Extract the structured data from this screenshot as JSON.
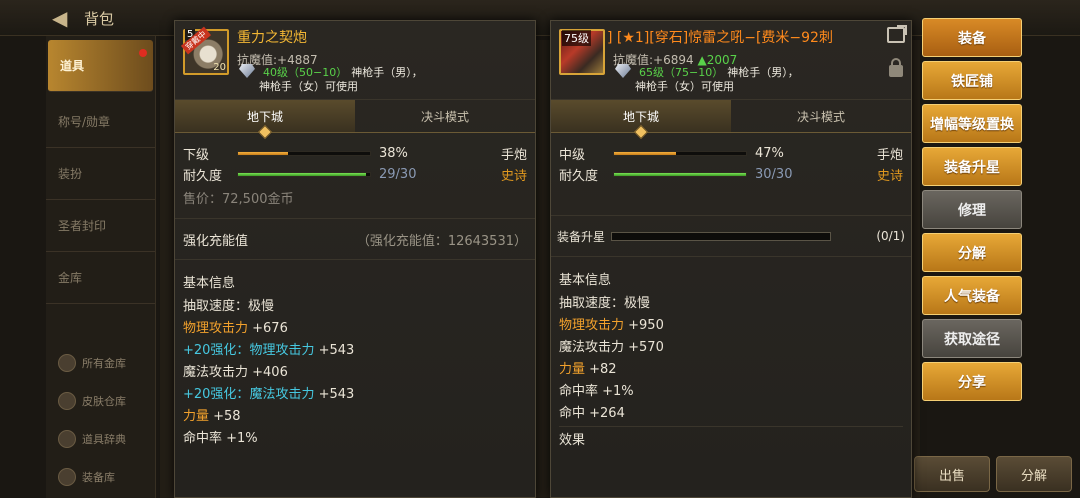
{
  "background": {
    "title": "背包",
    "sidebar": [
      "道具",
      "称号/勋章",
      "装扮",
      "圣者封印",
      "金库"
    ],
    "sidebar_sub": [
      "所有金库",
      "皮肤仓库",
      "道具辞典",
      "装备库"
    ],
    "bottom_buttons": [
      "出售",
      "分解"
    ]
  },
  "left": {
    "icon_level": "5",
    "icon_badge": "穿戴中",
    "icon_count": "20",
    "name": "重力之契炮",
    "resist_label": "抗魔值:",
    "resist_value": "+4887",
    "req_level": "40级（50−10）",
    "req_class1": "神枪手（男），",
    "req_class2": "神枪手（女）可使用",
    "tabs": [
      "地下城",
      "决斗模式"
    ],
    "grade_label": "下级",
    "grade_pct": 0.38,
    "grade_text": "38%",
    "durability_label": "耐久度",
    "durability": 0.9667,
    "durability_text": "29/30",
    "weapon_type": "手炮",
    "rarity": "史诗",
    "price": "售价：72,500金币",
    "enhance_label": "强化充能值",
    "enhance_value": "（强化充能值：12643531）",
    "basic_title": "基本信息",
    "attrs": {
      "speed": "抽取速度：极慢",
      "phys_label": "物理攻击力",
      "phys_value": " +676",
      "enh1_prefix": "+20强化：",
      "enh1_label": "物理攻击力",
      "enh1_value": " +543",
      "magic": "魔法攻击力 +406",
      "enh2_prefix": "+20强化：",
      "enh2_label": "魔法攻击力",
      "enh2_value": " +543",
      "str_label": "力量",
      "str_value": " +58",
      "hit": "命中率 +1%"
    }
  },
  "right": {
    "icon_level": "75级",
    "name": "]    [★1][穿石]惊雷之吼−[费米−92刺",
    "resist_label": "抗魔值:",
    "resist_value": "+6894",
    "resist_diff": "▲2007",
    "req_level": "65级（75−10）",
    "req_class1": "神枪手（男），",
    "req_class2": "神枪手（女）可使用",
    "tabs": [
      "地下城",
      "决斗模式"
    ],
    "grade_label": "中级",
    "grade_pct": 0.47,
    "grade_text": "47%",
    "durability_label": "耐久度",
    "durability": 1.0,
    "durability_text": "30/30",
    "weapon_type": "手炮",
    "rarity": "史诗",
    "upgrade_label": "装备升星",
    "upgrade_value": "(0/1)",
    "basic_title": "基本信息",
    "attrs": {
      "speed": "抽取速度：极慢",
      "phys_label": "物理攻击力",
      "phys_value": " +950",
      "magic": "魔法攻击力 +570",
      "str_label": "力量",
      "str_value": " +82",
      "hitrate": "命中率 +1%",
      "hit": "命中 +264",
      "effect": "效果"
    }
  },
  "menu": [
    "装备",
    "铁匠铺",
    "增幅等级置换",
    "装备升星",
    "修理",
    "分解",
    "人气装备",
    "获取途径",
    "分享"
  ]
}
